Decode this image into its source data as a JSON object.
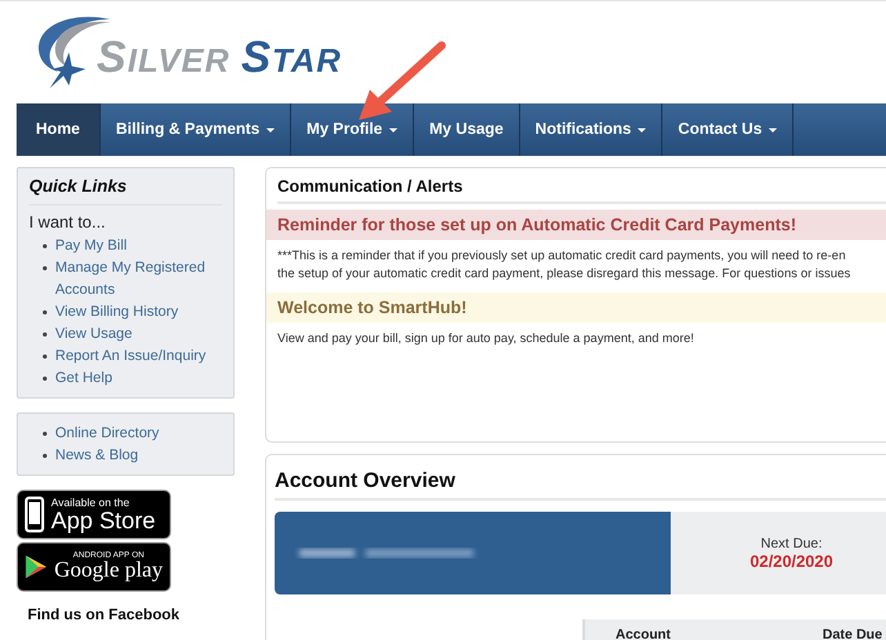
{
  "logo": {
    "word_1": "SILVER",
    "word_2": "STAR"
  },
  "nav": [
    {
      "label": "Home",
      "dropdown": false,
      "selected": true
    },
    {
      "label": "Billing & Payments",
      "dropdown": true,
      "selected": false
    },
    {
      "label": "My Profile",
      "dropdown": true,
      "selected": false
    },
    {
      "label": "My Usage",
      "dropdown": false,
      "selected": false
    },
    {
      "label": "Notifications",
      "dropdown": true,
      "selected": false
    },
    {
      "label": "Contact Us",
      "dropdown": true,
      "selected": false
    }
  ],
  "quick_links": {
    "title": "Quick Links",
    "subtitle": "I want to...",
    "items": [
      "Pay My Bill",
      "Manage My Registered Accounts",
      "View Billing History",
      "View Usage",
      "Report An Issue/Inquiry",
      "Get Help"
    ]
  },
  "more_links": [
    "Online Directory",
    "News & Blog"
  ],
  "app_store": {
    "line_1": "Available on the",
    "line_2": "App Store"
  },
  "google_play": {
    "line_1": "ANDROID APP ON",
    "line_2": "Google play"
  },
  "facebook": "Find us on Facebook",
  "alerts": {
    "title": "Communication / Alerts",
    "items": [
      {
        "kind": "danger",
        "heading": "Reminder for those set up on Automatic Credit Card Payments!",
        "lines": [
          "***This is a reminder that if you previously set up automatic credit card payments, you will need to re-en",
          "the setup of your automatic credit card payment, please disregard this message. For questions or issues"
        ]
      },
      {
        "kind": "warning",
        "heading": "Welcome to SmartHub!",
        "lines": [
          "View and pay your bill, sign up for auto pay, schedule a payment, and more!"
        ]
      }
    ]
  },
  "account_overview": {
    "title": "Account Overview",
    "next_due_label": "Next Due:",
    "next_due_date": "02/20/2020",
    "columns": [
      "Account",
      "Date Due"
    ]
  }
}
